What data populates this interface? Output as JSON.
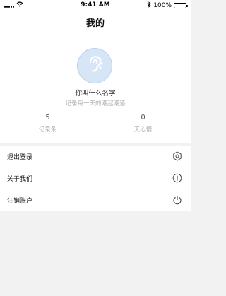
{
  "status_bar": {
    "time": "9:41 AM",
    "battery": "100%",
    "icons": [
      "signal-icon",
      "wifi-icon",
      "bluetooth-icon",
      "battery-icon"
    ]
  },
  "header": {
    "title": "我的"
  },
  "profile": {
    "name": "你叫什么名字",
    "signature": "记录每一天的潮起潮落",
    "avatar_icon": "ear-icon"
  },
  "stats": [
    {
      "value": "5",
      "label": "记录条"
    },
    {
      "value": "0",
      "label": "天心情"
    }
  ],
  "menu": [
    {
      "label": "退出登录",
      "icon": "settings-icon"
    },
    {
      "label": "关于我们",
      "icon": "info-icon"
    },
    {
      "label": "注销账户",
      "icon": "power-icon"
    }
  ],
  "colors": {
    "background": "#f2f2f2",
    "avatar_bg": "#d6e6f7",
    "avatar_icon": "#ffffff"
  }
}
